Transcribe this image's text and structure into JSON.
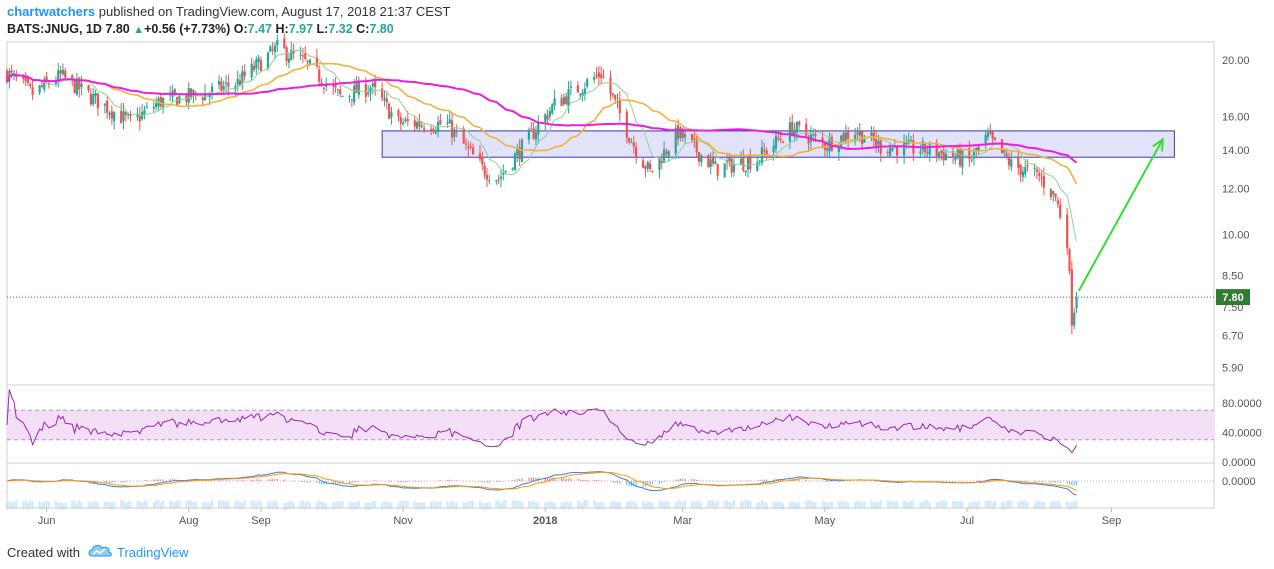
{
  "header": {
    "publisher": "chartwatchers",
    "published_text": "published on TradingView.com, August 17, 2018 21:37 CEST",
    "symbol": "BATS:JNUG, 1D",
    "last": "7.80",
    "change_icon": "up-triangle-icon",
    "change": "+0.56 (+7.73%)",
    "o_label": "O:",
    "o": "7.47",
    "h_label": "H:",
    "h": "7.97",
    "l_label": "L:",
    "l": "7.32",
    "c_label": "C:",
    "c": "7.80"
  },
  "footer": {
    "created_with": "Created with",
    "brand": "TradingView",
    "brand_icon": "tradingview-cloud-icon"
  },
  "colors": {
    "up": "#26a69a",
    "down": "#ef5350",
    "ma_fast": "#8fd48f",
    "ma_mid": "#f0b23b",
    "ma_slow": "#e91ee0",
    "box_fill": "#d8d8f8",
    "box_stroke": "#3a3ab0",
    "arrow": "#33dd33",
    "rsi": "#9c27b0",
    "rsi_band": "#f3e0f7",
    "price_tag": "#2e7d32"
  },
  "chart_data": [
    {
      "type": "candlestick",
      "pane": "price",
      "scale": "log",
      "ylim": [
        5.5,
        21.5
      ],
      "y_ticks": [
        "20.00",
        "16.00",
        "14.00",
        "12.00",
        "10.00",
        "8.50",
        "7.50",
        "6.70",
        "5.90"
      ],
      "x_ticks": [
        "Jun",
        "Aug",
        "Sep",
        "Nov",
        "2018",
        "Mar",
        "May",
        "Jul",
        "Sep"
      ],
      "last_price_label": "7.80",
      "x_range": [
        "2017-05-15",
        "2018-10-15"
      ],
      "anchors": [
        {
          "date": "2017-05-15",
          "close": 19.0
        },
        {
          "date": "2017-05-26",
          "close": 17.5
        },
        {
          "date": "2017-06-07",
          "close": 18.8
        },
        {
          "date": "2017-06-20",
          "close": 17.3
        },
        {
          "date": "2017-07-07",
          "close": 15.6
        },
        {
          "date": "2017-07-20",
          "close": 17.0
        },
        {
          "date": "2017-08-08",
          "close": 17.5
        },
        {
          "date": "2017-08-22",
          "close": 18.3
        },
        {
          "date": "2017-09-08",
          "close": 21.0
        },
        {
          "date": "2017-09-20",
          "close": 19.8
        },
        {
          "date": "2017-10-05",
          "close": 17.3
        },
        {
          "date": "2017-10-18",
          "close": 18.0
        },
        {
          "date": "2017-10-30",
          "close": 15.6
        },
        {
          "date": "2017-11-20",
          "close": 15.5
        },
        {
          "date": "2017-12-05",
          "close": 13.0
        },
        {
          "date": "2017-12-12",
          "close": 12.5
        },
        {
          "date": "2018-01-05",
          "close": 16.8
        },
        {
          "date": "2018-01-25",
          "close": 19.0
        },
        {
          "date": "2018-02-09",
          "close": 14.0
        },
        {
          "date": "2018-02-15",
          "close": 12.8
        },
        {
          "date": "2018-02-27",
          "close": 15.0
        },
        {
          "date": "2018-03-15",
          "close": 13.0
        },
        {
          "date": "2018-04-02",
          "close": 13.5
        },
        {
          "date": "2018-04-17",
          "close": 15.3
        },
        {
          "date": "2018-05-01",
          "close": 14.3
        },
        {
          "date": "2018-05-14",
          "close": 15.1
        },
        {
          "date": "2018-05-25",
          "close": 14.2
        },
        {
          "date": "2018-06-15",
          "close": 14.0
        },
        {
          "date": "2018-07-02",
          "close": 13.4
        },
        {
          "date": "2018-07-10",
          "close": 14.7
        },
        {
          "date": "2018-07-20",
          "close": 13.2
        },
        {
          "date": "2018-08-01",
          "close": 12.6
        },
        {
          "date": "2018-08-08",
          "close": 11.6
        },
        {
          "date": "2018-08-13",
          "close": 9.8
        },
        {
          "date": "2018-08-15",
          "close": 7.2
        },
        {
          "date": "2018-08-17",
          "close": 7.8
        }
      ],
      "moving_averages": [
        "ma_fast",
        "ma_mid",
        "ma_slow"
      ],
      "annotations": [
        {
          "type": "rectangle",
          "from": "2017-10-23",
          "to": "2018-09-28",
          "y_top": 15.1,
          "y_bottom": 13.6
        },
        {
          "type": "arrow",
          "from_date": "2018-08-18",
          "from_y": 8.0,
          "to_date": "2018-09-23",
          "to_y": 14.6
        }
      ]
    },
    {
      "type": "line",
      "pane": "rsi",
      "ylim": [
        0,
        100
      ],
      "y_ticks": [
        "80.0000",
        "40.0000",
        "0.0000"
      ],
      "band": [
        30,
        70
      ]
    },
    {
      "type": "line",
      "pane": "macd",
      "y_ticks": [
        "0.0000"
      ]
    }
  ]
}
